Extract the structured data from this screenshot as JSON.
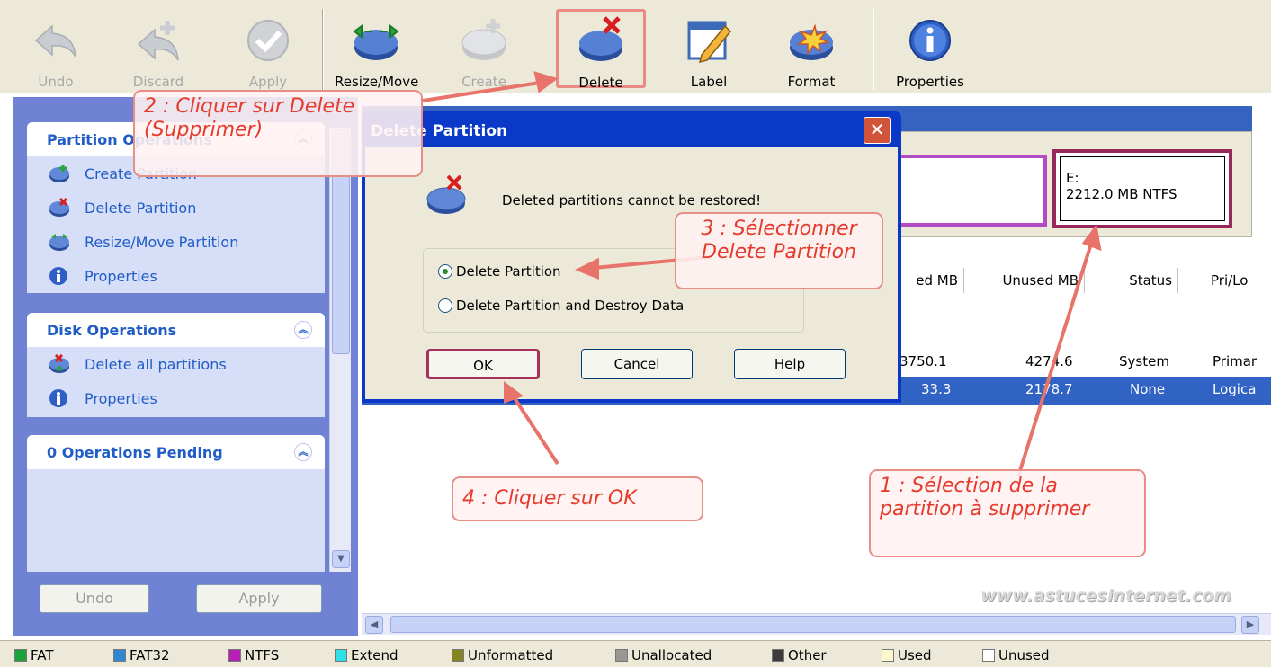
{
  "toolbar": {
    "undo": "Undo",
    "discard": "Discard",
    "apply": "Apply",
    "resize_move": "Resize/Move",
    "create": "Create",
    "delete": "Delete",
    "label": "Label",
    "format": "Format",
    "properties": "Properties"
  },
  "left_panel": {
    "partition_ops": {
      "title": "Partition Operations",
      "items": [
        "Create Partition",
        "Delete Partition",
        "Resize/Move Partition",
        "Properties"
      ]
    },
    "disk_ops": {
      "title": "Disk Operations",
      "items": [
        "Delete all partitions",
        "Properties"
      ]
    },
    "pending": {
      "title": "0 Operations Pending"
    },
    "undo_button": "Undo",
    "apply_button": "Apply"
  },
  "disk_map": {
    "selected_partition": {
      "letter": "E:",
      "info": "2212.0 MB  NTFS"
    }
  },
  "table": {
    "headers": [
      "ed MB",
      "Unused MB",
      "Status",
      "Pri/Lo"
    ],
    "rows": [
      {
        "used": "3750.1",
        "unused": "4274.6",
        "status": "System",
        "type": "Primar"
      },
      {
        "used": "33.3",
        "unused": "2178.7",
        "status": "None",
        "type": "Logica"
      }
    ]
  },
  "dialog": {
    "title": "Delete Partition",
    "close": "✕",
    "message": "Deleted partitions cannot be restored!",
    "option1": "Delete Partition",
    "option2": "Delete Partition and Destroy Data",
    "ok": "OK",
    "cancel": "Cancel",
    "help": "Help"
  },
  "annotations": {
    "step1_line1": "1 : Sélection de la",
    "step1_line2": "partition à supprimer",
    "step2_line1": "2 : Cliquer sur Delete",
    "step2_line2": "(Supprimer)",
    "step3_line1": "3 : Sélectionner",
    "step3_line2": "Delete Partition",
    "step4": "4 : Cliquer sur OK"
  },
  "watermark": "www.astucesinternet.com",
  "legend": [
    "FAT",
    "FAT32",
    "NTFS",
    "Extend",
    "Unformatted",
    "Unallocated",
    "Other",
    "Used",
    "Unused"
  ],
  "legend_colors": [
    "#1ea33b",
    "#2f86d1",
    "#b521b5",
    "#2ee1e6",
    "#858524",
    "#999794",
    "#3b3b3b",
    "#fff7cc",
    "#ffffff"
  ],
  "colors": {
    "accent": "#3763c0",
    "annotation": "#e53a2c"
  }
}
